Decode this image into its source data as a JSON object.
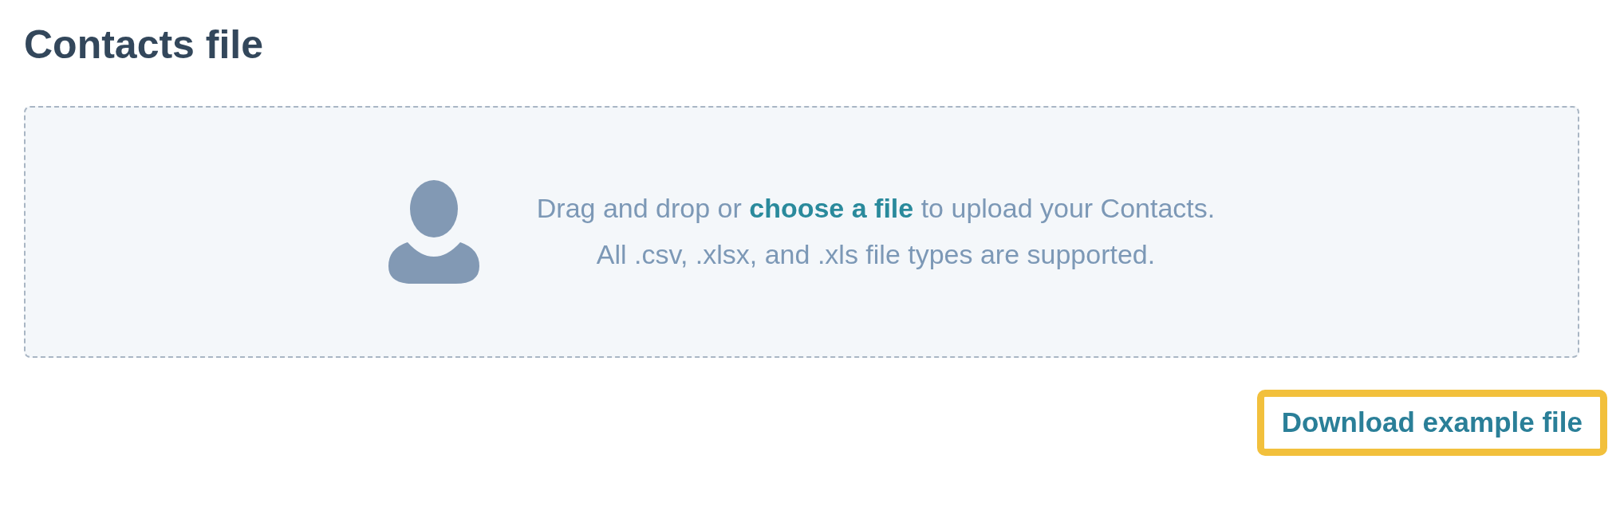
{
  "heading": "Contacts file",
  "dropzone": {
    "line_1": "Drag and drop or **choose a file** to upload your Contacts.",
    "line_2": "All .csv, .xlsx, and .xls file types are supported."
  },
  "download_link": {
    "label": "Download example file",
    "highlighted": true
  }
}
